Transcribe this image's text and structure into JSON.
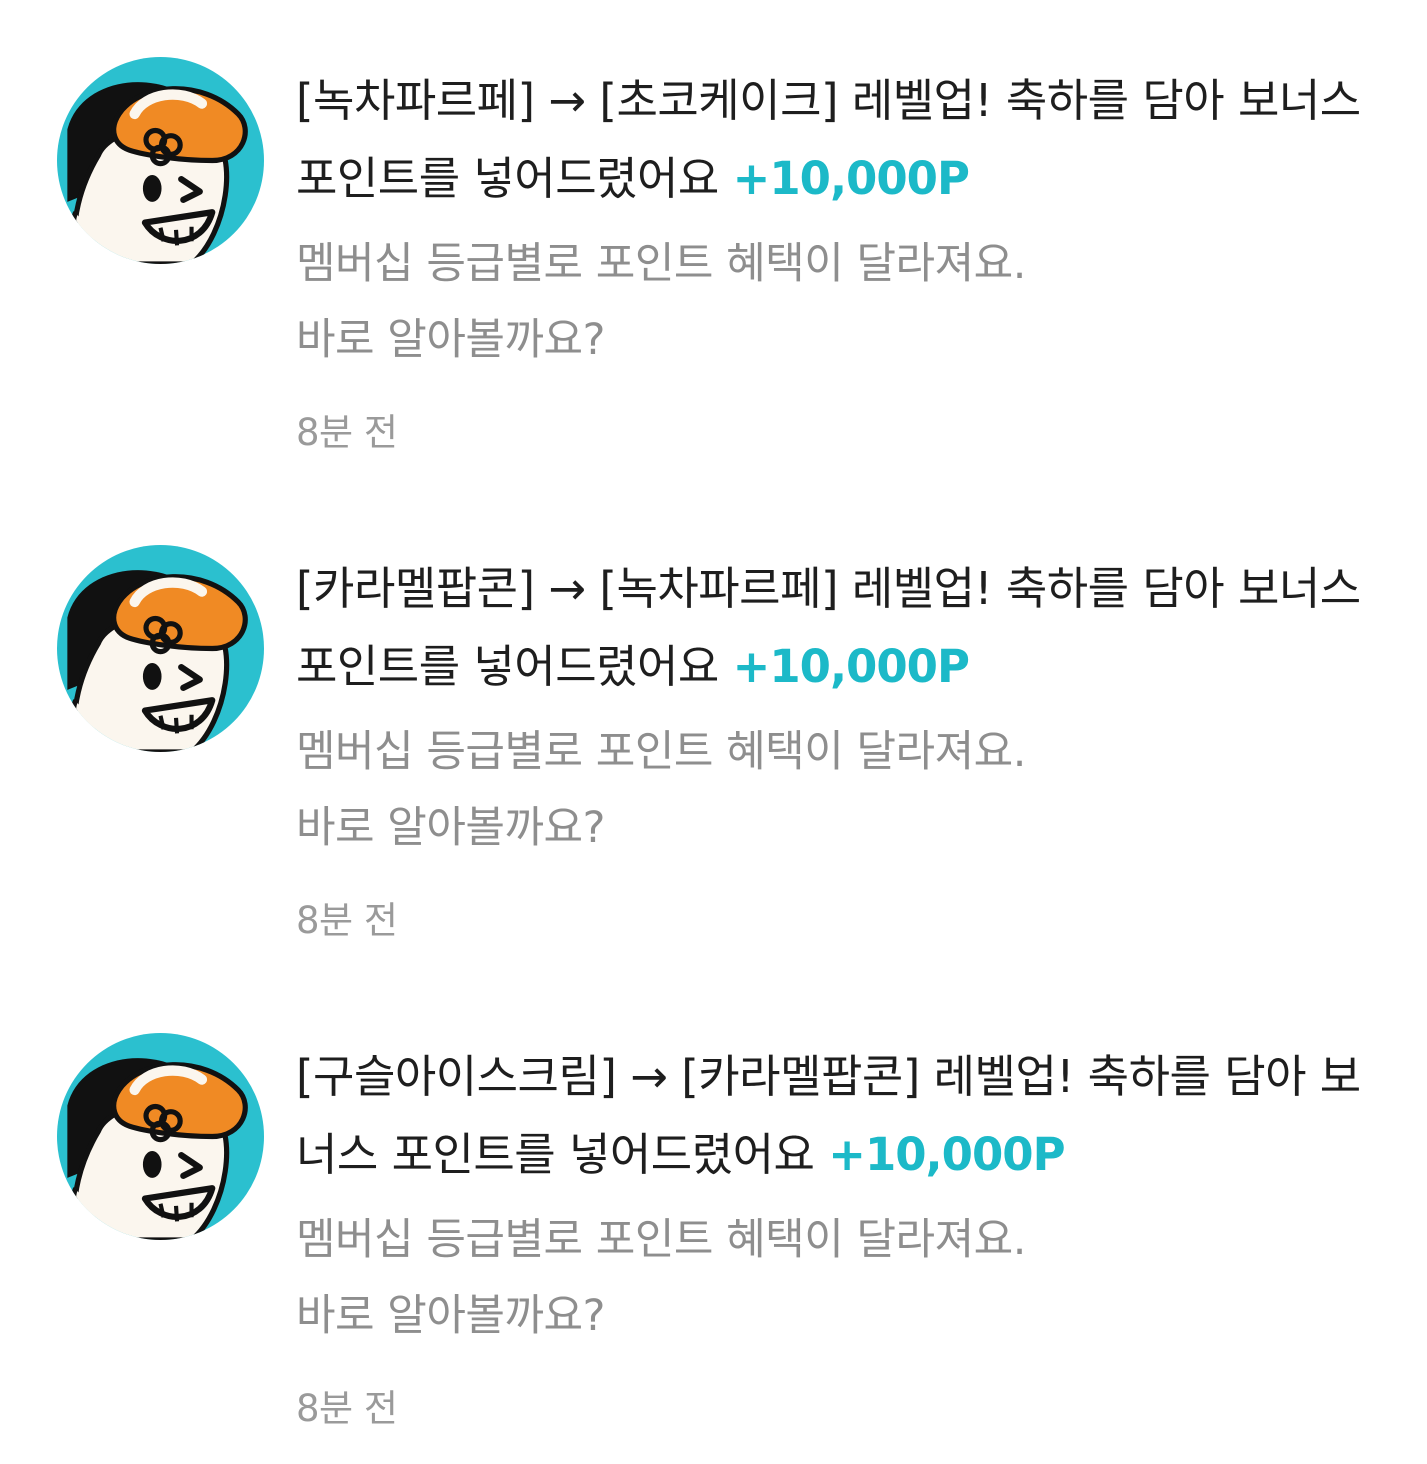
{
  "notifications": [
    {
      "avatar_icon": "cartoon-mascot-avatar",
      "title": "[녹차파르페] → [초코케이크] 레벨업! 축하를 담아 보너스 포인트를 넣어드렸어요",
      "points": "+10,000P",
      "desc_line1": "멤버십 등급별로 포인트 혜택이 달라져요.",
      "desc_line2": "바로 알아볼까요?",
      "time": "8분 전"
    },
    {
      "avatar_icon": "cartoon-mascot-avatar",
      "title": "[카라멜팝콘] → [녹차파르페] 레벨업! 축하를 담아 보너스 포인트를 넣어드렸어요",
      "points": "+10,000P",
      "desc_line1": "멤버십 등급별로 포인트 혜택이 달라져요.",
      "desc_line2": "바로 알아볼까요?",
      "time": "8분 전"
    },
    {
      "avatar_icon": "cartoon-mascot-avatar",
      "title": "[구슬아이스크림] → [카라멜팝콘] 레벨업! 축하를 담아 보너스 포인트를 넣어드렸어요",
      "points": "+10,000P",
      "desc_line1": "멤버십 등급별로 포인트 혜택이 달라져요.",
      "desc_line2": "바로 알아볼까요?",
      "time": "8분 전"
    }
  ],
  "colors": {
    "accent": "#1cb9c8",
    "avatar_bg": "#2bc0cf",
    "avatar_cap": "#f08a24",
    "title_text": "#1e1e1e",
    "desc_text": "#8e8e8e"
  }
}
